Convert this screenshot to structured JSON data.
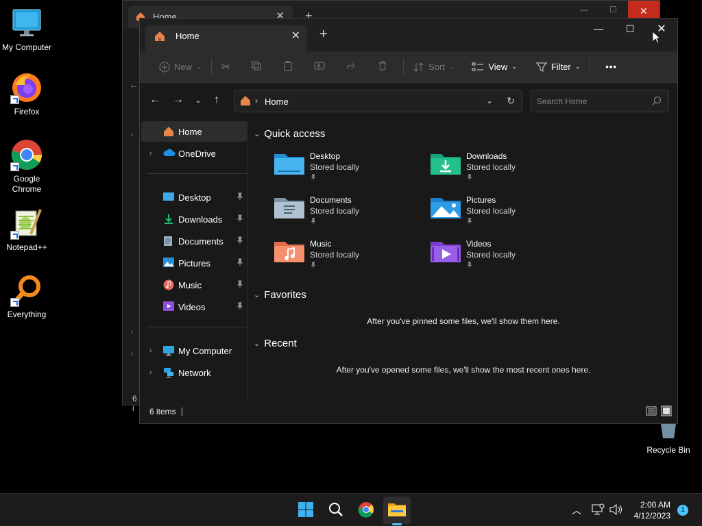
{
  "desktop": {
    "icons": [
      {
        "label": "My Computer",
        "icon": "monitor-icon"
      },
      {
        "label": "Firefox",
        "icon": "firefox-icon"
      },
      {
        "label": "Google Chrome",
        "icon": "chrome-icon"
      },
      {
        "label": "Notepad++",
        "icon": "notepad-plus-plus-icon"
      },
      {
        "label": "Everything",
        "icon": "everything-search-icon"
      },
      {
        "label": "Recycle Bin",
        "icon": "recycle-bin-icon"
      }
    ]
  },
  "back_window": {
    "tab_title": "Home",
    "status_text": "6 i"
  },
  "window": {
    "tab_title": "Home",
    "toolbar": {
      "new_label": "New",
      "sort_label": "Sort",
      "view_label": "View",
      "filter_label": "Filter",
      "more_label": "•••"
    },
    "address": {
      "crumb": "Home",
      "separator": "›"
    },
    "search": {
      "placeholder": "Search Home"
    },
    "sidebar": {
      "items": [
        {
          "label": "Home"
        },
        {
          "label": "OneDrive"
        },
        {
          "label": "Desktop"
        },
        {
          "label": "Downloads"
        },
        {
          "label": "Documents"
        },
        {
          "label": "Pictures"
        },
        {
          "label": "Music"
        },
        {
          "label": "Videos"
        },
        {
          "label": "My Computer"
        },
        {
          "label": "Network"
        }
      ]
    },
    "content": {
      "quick_access_title": "Quick access",
      "quick_access": [
        {
          "name": "Desktop",
          "sub": "Stored locally"
        },
        {
          "name": "Downloads",
          "sub": "Stored locally"
        },
        {
          "name": "Documents",
          "sub": "Stored locally"
        },
        {
          "name": "Pictures",
          "sub": "Stored locally"
        },
        {
          "name": "Music",
          "sub": "Stored locally"
        },
        {
          "name": "Videos",
          "sub": "Stored locally"
        }
      ],
      "favorites_title": "Favorites",
      "favorites_empty": "After you've pinned some files, we'll show them here.",
      "recent_title": "Recent",
      "recent_empty": "After you've opened some files, we'll show the most recent ones here."
    },
    "status": {
      "items": "6 items"
    }
  },
  "taskbar": {
    "time": "2:00 AM",
    "date": "4/12/2023",
    "notification_count": "1"
  }
}
